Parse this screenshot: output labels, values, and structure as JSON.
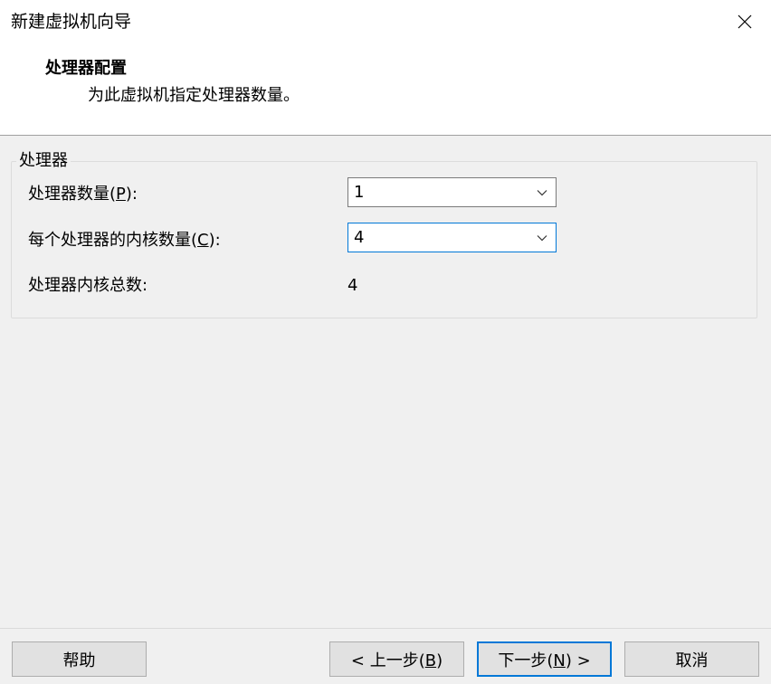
{
  "window": {
    "title": "新建虚拟机向导",
    "close_icon": "close-icon"
  },
  "header": {
    "heading": "处理器配置",
    "subtitle": "为此虚拟机指定处理器数量。"
  },
  "processor_group": {
    "legend": "处理器",
    "processor_count": {
      "label_before": "处理器数量(",
      "mnemonic": "P",
      "label_after": "):",
      "value": "1"
    },
    "cores_per_processor": {
      "label_before": "每个处理器的内核数量(",
      "mnemonic": "C",
      "label_after": "):",
      "value": "4"
    },
    "total_cores": {
      "label": "处理器内核总数:",
      "value": "4"
    }
  },
  "footer": {
    "help": "帮助",
    "back": {
      "before": "< 上一步(",
      "mnemonic": "B",
      "after": ")"
    },
    "next": {
      "before": "下一步(",
      "mnemonic": "N",
      "after": ") >"
    },
    "cancel": "取消"
  },
  "colors": {
    "accent": "#0078d7",
    "button_face": "#e1e1e1",
    "dialog_bg": "#f0f0f0"
  }
}
